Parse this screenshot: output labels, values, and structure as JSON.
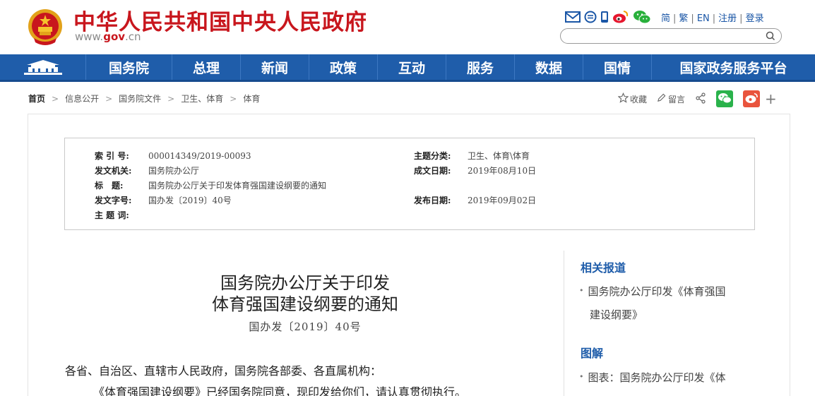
{
  "header": {
    "site_title": "中华人民共和国中央人民政府",
    "url_prefix": "www.",
    "url_brand": "gov",
    "url_suffix": ".cn",
    "icons": [
      "mail-icon",
      "message-icon",
      "mobile-icon",
      "weibo-icon",
      "wechat-icon"
    ],
    "lang_links": [
      "简",
      "繁",
      "EN",
      "注册",
      "登录"
    ],
    "search_placeholder": ""
  },
  "nav": {
    "items": [
      "国务院",
      "总理",
      "新闻",
      "政策",
      "互动",
      "服务",
      "数据",
      "国情",
      "国家政务服务平台"
    ]
  },
  "breadcrumb": [
    "首页",
    "信息公开",
    "国务院文件",
    "卫生、体育",
    "体育"
  ],
  "tools": {
    "favorite": "收藏",
    "comment": "留言"
  },
  "meta": {
    "index_label": "索 引 号:",
    "index_value": "000014349/2019-00093",
    "topic_label": "主题分类:",
    "topic_value": "卫生、体育\\体育",
    "issuer_label": "发文机关:",
    "issuer_value": "国务院办公厅",
    "date_label": "成文日期:",
    "date_value": "2019年08月10日",
    "title_label": "标　题:",
    "title_value": "国务院办公厅关于印发体育强国建设纲要的通知",
    "docno_label": "发文字号:",
    "docno_value": "国办发〔2019〕40号",
    "pub_label": "发布日期:",
    "pub_value": "2019年09月02日",
    "keywords_label": "主 题 词:",
    "keywords_value": ""
  },
  "article": {
    "title_line1": "国务院办公厅关于印发",
    "title_line2": "体育强国建设纲要的通知",
    "doc_no": "国办发〔2019〕40号",
    "para1": "各省、自治区、直辖市人民政府，国务院各部委、各直属机构：",
    "para2": "《体育强国建设纲要》已经国务院同意，现印发给你们，请认真贯彻执行。"
  },
  "sidebar": {
    "related_title": "相关报道",
    "related_line1": "国务院办公厅印发《体育强国",
    "related_line2": "建设纲要》",
    "graphic_title": "图解",
    "graphic_line1": "图表：国务院办公厅印发《体"
  },
  "colors": {
    "brand_red": "#c8161d",
    "nav_blue": "#1f5daa",
    "link_blue": "#1a56a6"
  }
}
